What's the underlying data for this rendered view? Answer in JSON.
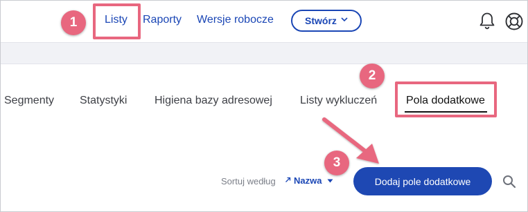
{
  "nav": {
    "links": [
      "Listy",
      "Raporty",
      "Wersje robocze"
    ],
    "create_label": "Stwórz",
    "icons": [
      "bell-icon",
      "lifebuoy-icon"
    ]
  },
  "tabs": [
    "Segmenty",
    "Statystyki",
    "Higiena bazy adresowej",
    "Listy wykluczeń",
    "Pola dodatkowe"
  ],
  "active_tab": "Pola dodatkowe",
  "sort": {
    "label": "Sortuj według",
    "value": "Nazwa"
  },
  "add_button": "Dodaj pole dodatkowe",
  "annotations": {
    "step1": "1",
    "step2": "2",
    "step3": "3"
  },
  "colors": {
    "accent": "#1e48b3",
    "highlight": "#e8677f",
    "band": "#f1f2f6"
  }
}
